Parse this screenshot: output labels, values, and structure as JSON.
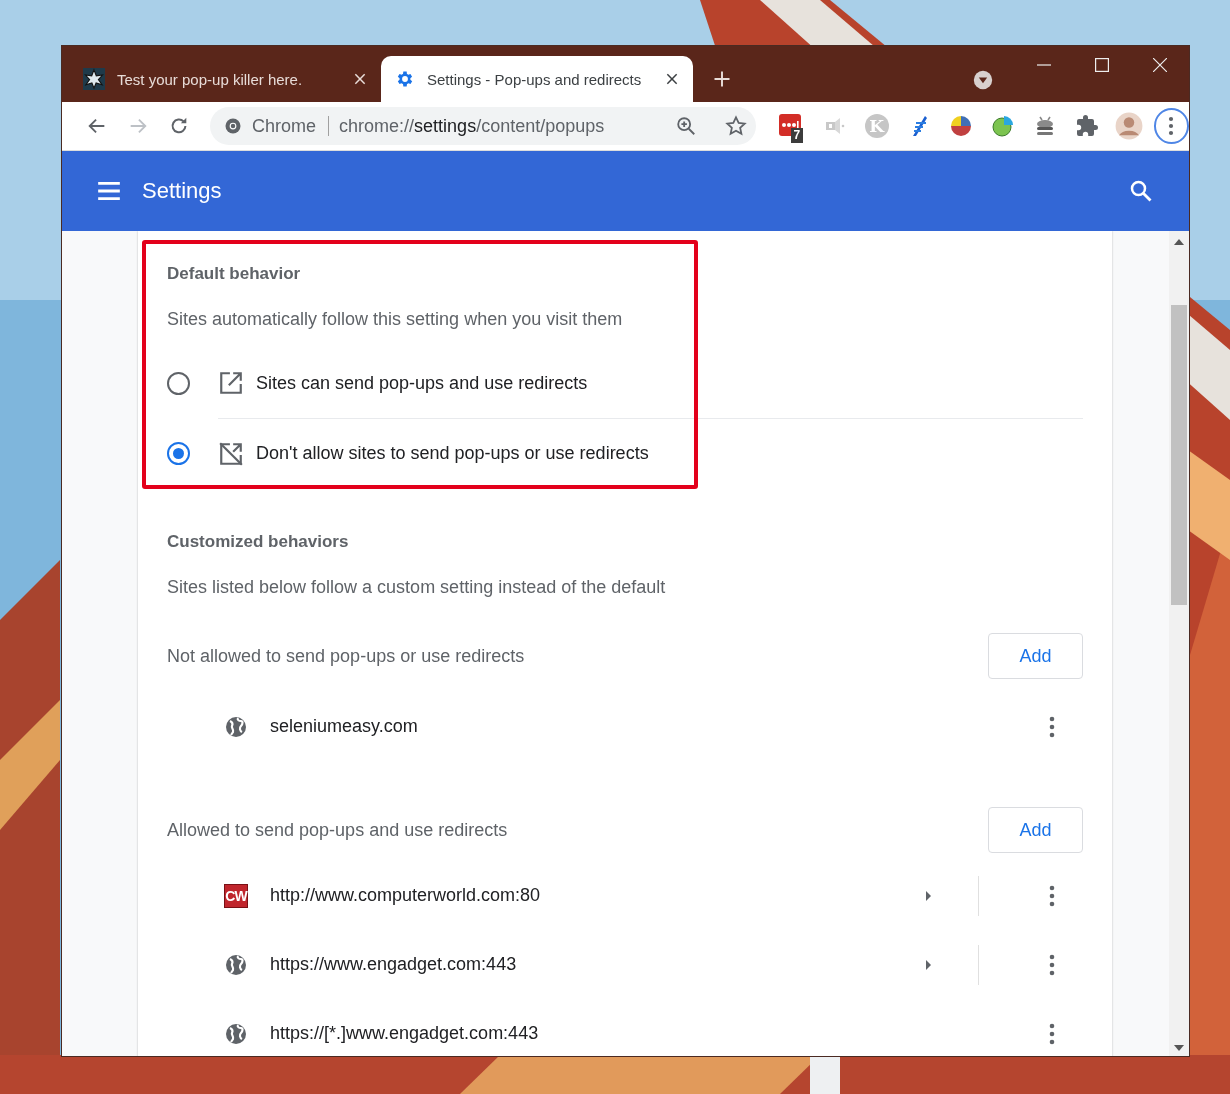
{
  "tabs": [
    {
      "title": "Test your pop-up killer here.",
      "kind": "site",
      "selected": false
    },
    {
      "title": "Settings - Pop-ups and redirects",
      "kind": "settings",
      "selected": true
    }
  ],
  "omnibox": {
    "chip": "Chrome",
    "url": "chrome://**settings**/content/popups"
  },
  "extensions": [
    {
      "kind": "lastpass",
      "badge": "7"
    },
    {
      "kind": "mute"
    },
    {
      "kind": "letter",
      "letter": "K"
    },
    {
      "kind": "feather"
    },
    {
      "kind": "pie"
    },
    {
      "kind": "chart"
    },
    {
      "kind": "stack"
    },
    {
      "kind": "puzzle"
    },
    {
      "kind": "avatar"
    }
  ],
  "header": {
    "title": "Settings"
  },
  "default_behavior": {
    "title": "Default behavior",
    "description": "Sites automatically follow this setting when you visit them",
    "options": [
      {
        "label": "Sites can send pop-ups and use redirects",
        "kind": "allow",
        "selected": false
      },
      {
        "label": "Don't allow sites to send pop-ups or use redirects",
        "kind": "block",
        "selected": true
      }
    ]
  },
  "customized": {
    "title": "Customized behaviors",
    "description": "Sites listed below follow a custom setting instead of the default",
    "groups": [
      {
        "title": "Not allowed to send pop-ups or use redirects",
        "add_button": "Add",
        "sites": [
          {
            "name": "seleniumeasy.com",
            "kind": "globe",
            "expandable": false
          }
        ]
      },
      {
        "title": "Allowed to send pop-ups and use redirects",
        "add_button": "Add",
        "sites": [
          {
            "name": "http://www.computerworld.com:80",
            "kind": "badge",
            "favicon_text": "CW",
            "expandable": true
          },
          {
            "name": "https://www.engadget.com:443",
            "kind": "globe",
            "expandable": true
          },
          {
            "name": "https://[*.]www.engadget.com:443",
            "kind": "globe",
            "expandable": false
          }
        ]
      }
    ]
  }
}
